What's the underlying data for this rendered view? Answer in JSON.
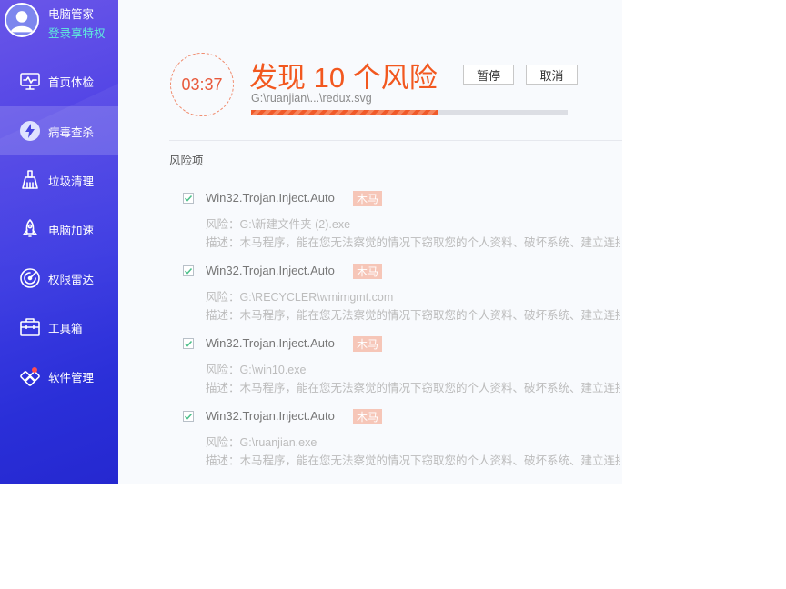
{
  "profile": {
    "name": "电脑管家",
    "link": "登录享特权"
  },
  "nav": [
    {
      "label": "首页体检",
      "icon": "monitor-icon",
      "active": false
    },
    {
      "label": "病毒查杀",
      "icon": "lightning-shield-icon",
      "active": true
    },
    {
      "label": "垃圾清理",
      "icon": "broom-icon",
      "active": false
    },
    {
      "label": "电脑加速",
      "icon": "rocket-icon",
      "active": false
    },
    {
      "label": "权限雷达",
      "icon": "radar-icon",
      "active": false
    },
    {
      "label": "工具箱",
      "icon": "toolbox-icon",
      "active": false
    },
    {
      "label": "软件管理",
      "icon": "apps-icon",
      "active": false
    }
  ],
  "scan": {
    "timer": "03:37",
    "headline": "发现 10 个风险",
    "path": "G:\\ruanjian\\...\\redux.svg",
    "progress_percent": 59,
    "pause_label": "暂停",
    "cancel_label": "取消"
  },
  "section_title": "风险项",
  "risks": [
    {
      "name": "Win32.Trojan.Inject.Auto",
      "tag": "木马",
      "path": "风险：G:\\新建文件夹 (2).exe",
      "desc": "描述：木马程序，能在您无法察觉的情况下窃取您的个人资料、破坏系统、建立连接...",
      "checked": true
    },
    {
      "name": "Win32.Trojan.Inject.Auto",
      "tag": "木马",
      "path": "风险：G:\\RECYCLER\\wmimgmt.com",
      "desc": "描述：木马程序，能在您无法察觉的情况下窃取您的个人资料、破坏系统、建立连接...",
      "checked": true
    },
    {
      "name": "Win32.Trojan.Inject.Auto",
      "tag": "木马",
      "path": "风险：G:\\win10.exe",
      "desc": "描述：木马程序，能在您无法察觉的情况下窃取您的个人资料、破坏系统、建立连接...",
      "checked": true
    },
    {
      "name": "Win32.Trojan.Inject.Auto",
      "tag": "木马",
      "path": "风险：G:\\ruanjian.exe",
      "desc": "描述：木马程序，能在您无法察觉的情况下窃取您的个人资料、破坏系统、建立连接...",
      "checked": true
    }
  ],
  "colors": {
    "accent": "#f2581f",
    "sidebar": "#3d3ce2",
    "link": "#5ff0dc",
    "tag_bg": "#f6c6b8",
    "check": "#4cc08a"
  }
}
